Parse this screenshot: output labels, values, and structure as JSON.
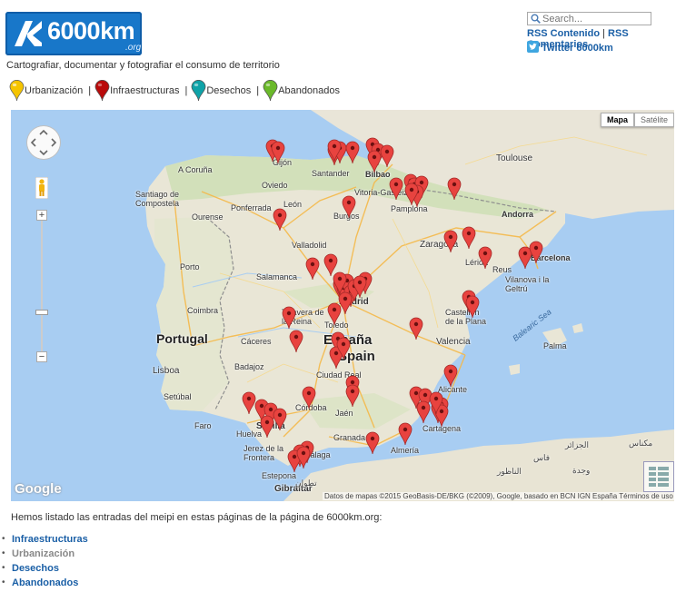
{
  "site": {
    "logo_text": "6000km",
    "logo_suffix": ".org",
    "tagline": "Cartografiar, documentar y fotografiar el consumo de territorio"
  },
  "search": {
    "placeholder": "Search..."
  },
  "links": {
    "rss_contenido": "RSS Contenido",
    "separator": "|",
    "rss_comentarios": "RSS Comentarios",
    "twitter": "Twitter 6000km"
  },
  "legend": {
    "items": [
      {
        "label": "Urbanización",
        "color": "#f5c400"
      },
      {
        "label": "Infraestructuras",
        "color": "#b90b0b"
      },
      {
        "label": "Desechos",
        "color": "#0fa3a8"
      },
      {
        "label": "Abandonados",
        "color": "#6ab92a"
      }
    ],
    "separator": "|"
  },
  "map": {
    "type_buttons": {
      "map": "Mapa",
      "satellite": "Satélite"
    },
    "google_logo": "Google",
    "credits": "Datos de mapas ©2015 GeoBasis-DE/BKG (©2009), Google, basado en BCN IGN España   Términos de uso",
    "marker_color": "#e8433f",
    "labels": {
      "countries": {
        "spain1": "España",
        "spain2": "Spain",
        "portugal": "Portugal"
      },
      "seas": {
        "balearic": "Balearic Sea"
      },
      "gibraltar": "Gibraltar",
      "andorra": "Andorra",
      "cities": [
        "A Coruña",
        "Santiago de Compostela",
        "Ourense",
        "Ponferrada",
        "León",
        "Oviedo",
        "Gijón",
        "Santander",
        "Bilbao",
        "Vitoria-Gasteiz",
        "Pamplona",
        "Burgos",
        "Valladolid",
        "Salamanca",
        "Porto",
        "Coimbra",
        "Lisboa",
        "Setúbal",
        "Badajoz",
        "Cáceres",
        "Talavera de la Reina",
        "Toledo",
        "Ciudad Real",
        "Córdoba",
        "Sevilla",
        "Huelva",
        "Jerez de la Frontera",
        "Estepona",
        "Málaga",
        "Granada",
        "Almería",
        "Jaén",
        "Cartagena",
        "Alicante",
        "Valencia",
        "Castellón de la Plana",
        "Zaragoza",
        "Reus",
        "Barcelona",
        "Vilanova i la Geltrú",
        "Toulouse",
        "Palma",
        "Faro",
        "Lérida",
        "Madrid"
      ],
      "north_africa": [
        "الجزائر",
        "تطوان",
        "وجدة",
        "الناظور",
        "فاس",
        "مكناس"
      ]
    }
  },
  "content": {
    "intro": "Hemos listado las entradas del meipi en estas páginas de la página de 6000km.org:",
    "categories": [
      "Infraestructuras",
      "Urbanización",
      "Desechos",
      "Abandonados"
    ]
  }
}
